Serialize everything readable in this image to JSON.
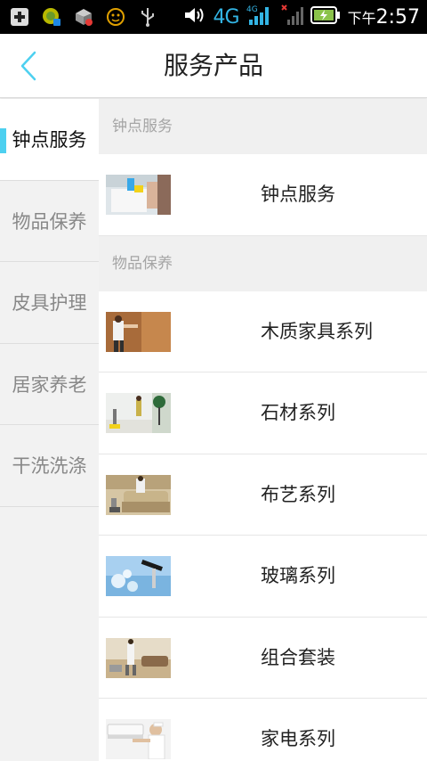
{
  "status_bar": {
    "network": "4G",
    "network_small": "4G",
    "time_prefix": "下午",
    "time": "2:57"
  },
  "header": {
    "title": "服务产品",
    "back_icon": "chevron-left-icon"
  },
  "sidebar": {
    "items": [
      {
        "label": "钟点服务",
        "active": true
      },
      {
        "label": "物品保养",
        "active": false
      },
      {
        "label": "皮具护理",
        "active": false
      },
      {
        "label": "居家养老",
        "active": false
      },
      {
        "label": "干洗洗涤",
        "active": false
      }
    ]
  },
  "sections": [
    {
      "title": "钟点服务",
      "items": [
        {
          "label": "钟点服务"
        }
      ]
    },
    {
      "title": "物品保养",
      "items": [
        {
          "label": "木质家具系列"
        },
        {
          "label": "石材系列"
        },
        {
          "label": "布艺系列"
        },
        {
          "label": "玻璃系列"
        },
        {
          "label": "组合套装"
        },
        {
          "label": "家电系列"
        }
      ]
    }
  ],
  "colors": {
    "accent": "#4dd0f0",
    "back_arrow": "#4dd0f0",
    "section_text": "#a5a5a5"
  }
}
